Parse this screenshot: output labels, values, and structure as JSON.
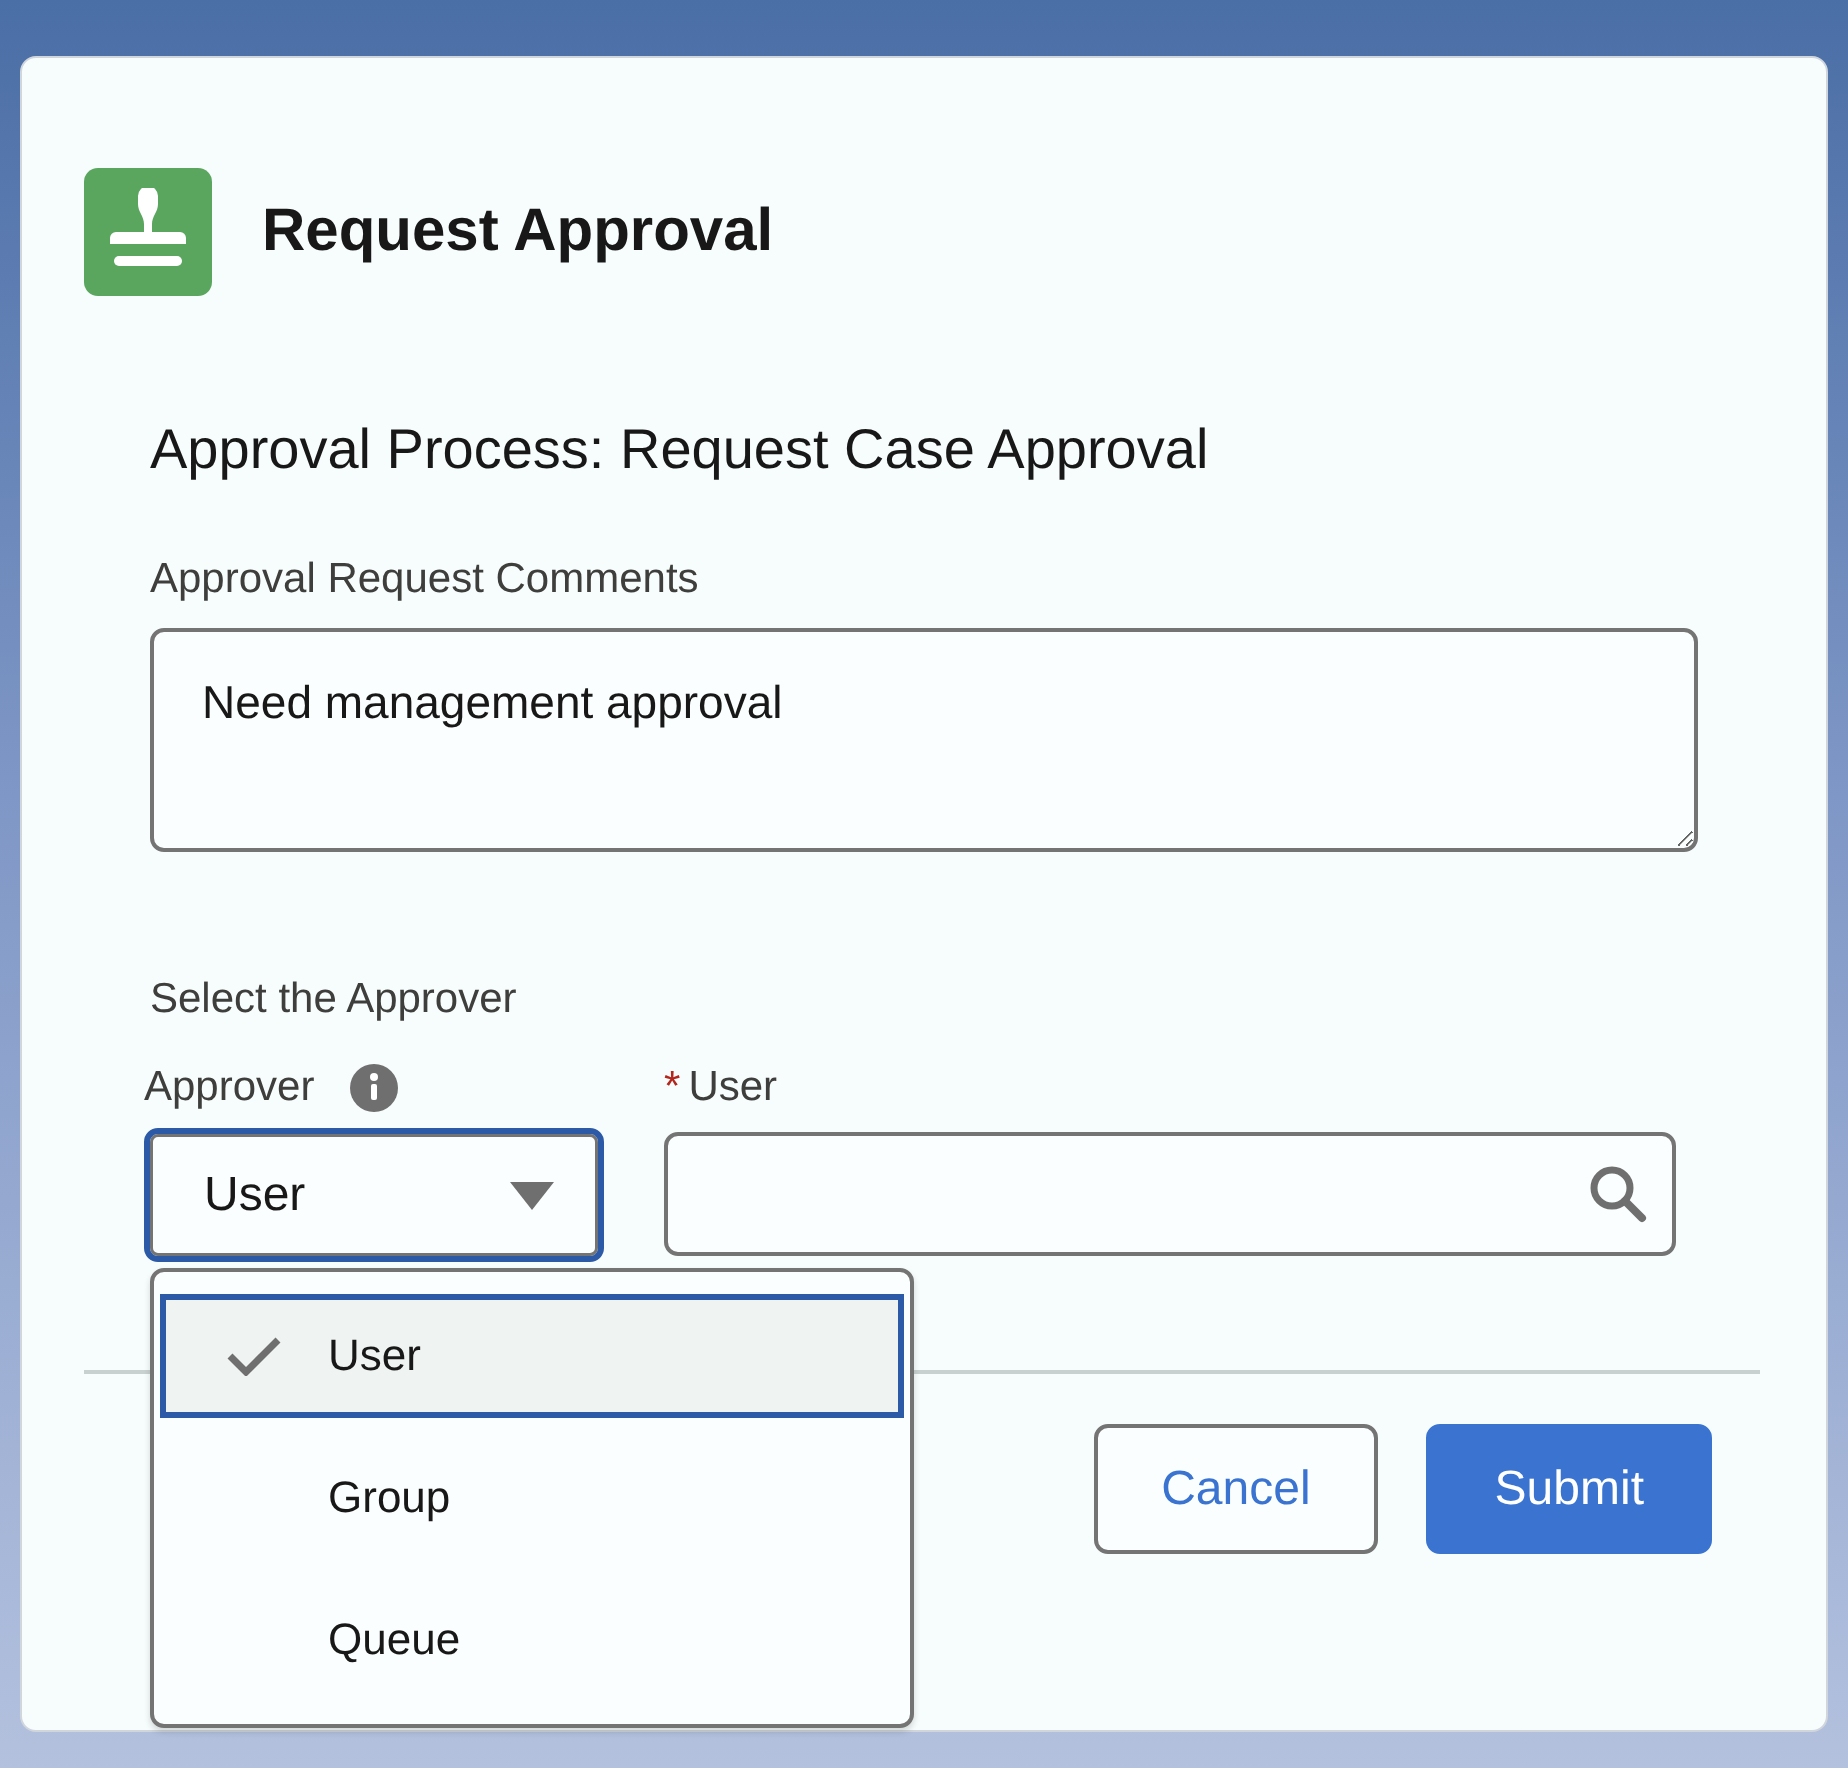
{
  "dialog": {
    "title": "Request Approval",
    "heading": "Approval Process: Request Case Approval",
    "comments": {
      "label": "Approval Request Comments",
      "value": "Need management approval"
    },
    "section_title": "Select the Approver",
    "approver": {
      "label": "Approver",
      "value": "User",
      "expanded": true,
      "options": [
        {
          "label": "User",
          "selected": true
        },
        {
          "label": "Group",
          "selected": false
        },
        {
          "label": "Queue",
          "selected": false
        }
      ]
    },
    "user_field": {
      "required_mark": "*",
      "label": "User"
    },
    "buttons": [
      {
        "label": "Cancel",
        "kind": "neutral"
      },
      {
        "label": "Submit",
        "kind": "brand"
      }
    ]
  }
}
